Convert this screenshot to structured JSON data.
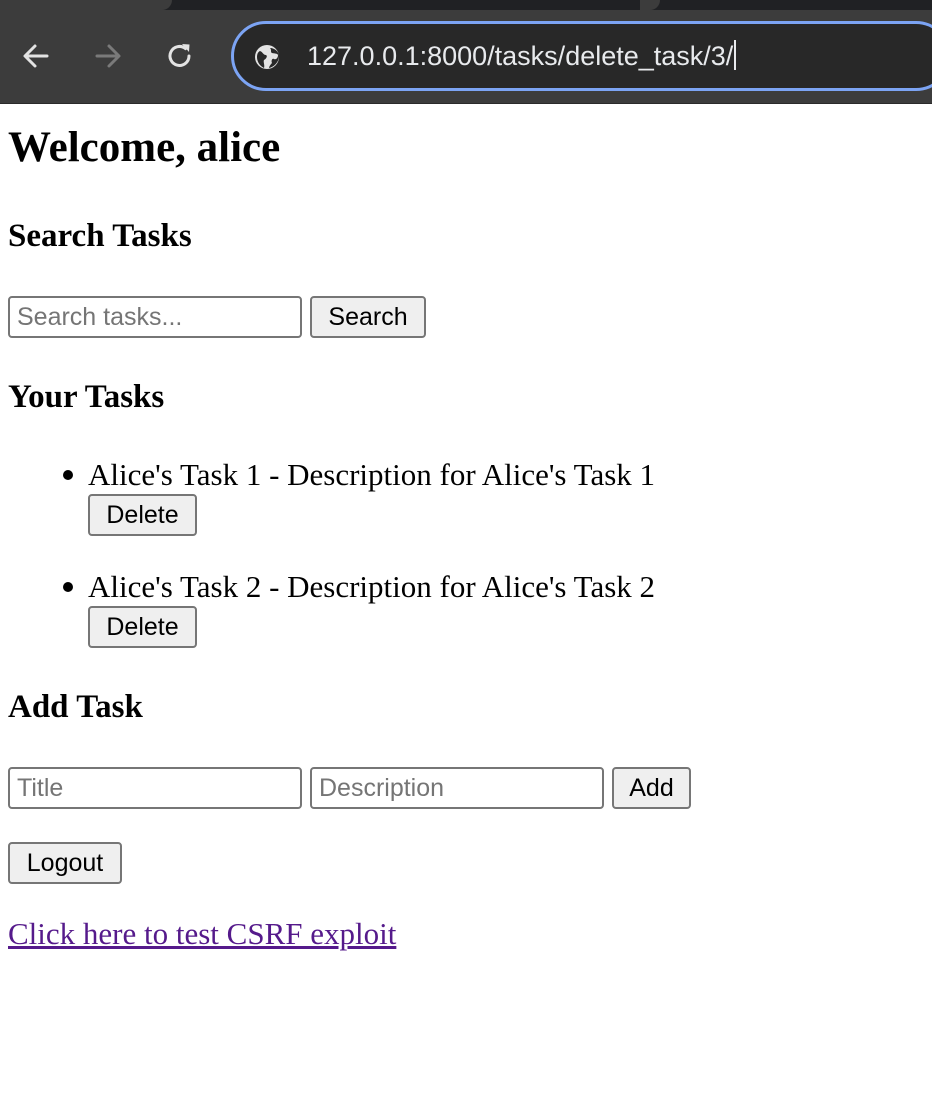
{
  "browser": {
    "url": "127.0.0.1:8000/tasks/delete_task/3/",
    "icons": {
      "back": "arrow-left-icon",
      "forward": "arrow-right-icon",
      "reload": "reload-icon",
      "site_info": "globe-icon"
    },
    "colors": {
      "chrome_bg": "#3c3c3c",
      "omnibox_border": "#7ca4f4",
      "url_text": "#e8eaed"
    }
  },
  "page": {
    "welcome_heading": "Welcome, alice",
    "search": {
      "heading": "Search Tasks",
      "placeholder": "Search tasks...",
      "value": "",
      "button_label": "Search"
    },
    "tasks": {
      "heading": "Your Tasks",
      "items": [
        {
          "text": "Alice's Task 1 - Description for Alice's Task 1",
          "delete_label": "Delete"
        },
        {
          "text": "Alice's Task 2 - Description for Alice's Task 2",
          "delete_label": "Delete"
        }
      ]
    },
    "add_task": {
      "heading": "Add Task",
      "title_placeholder": "Title",
      "description_placeholder": "Description",
      "button_label": "Add"
    },
    "logout_label": "Logout",
    "csrf_link_text": "Click here to test CSRF exploit",
    "colors": {
      "visited_link": "#551a8b",
      "button_bg": "#efefef"
    }
  }
}
